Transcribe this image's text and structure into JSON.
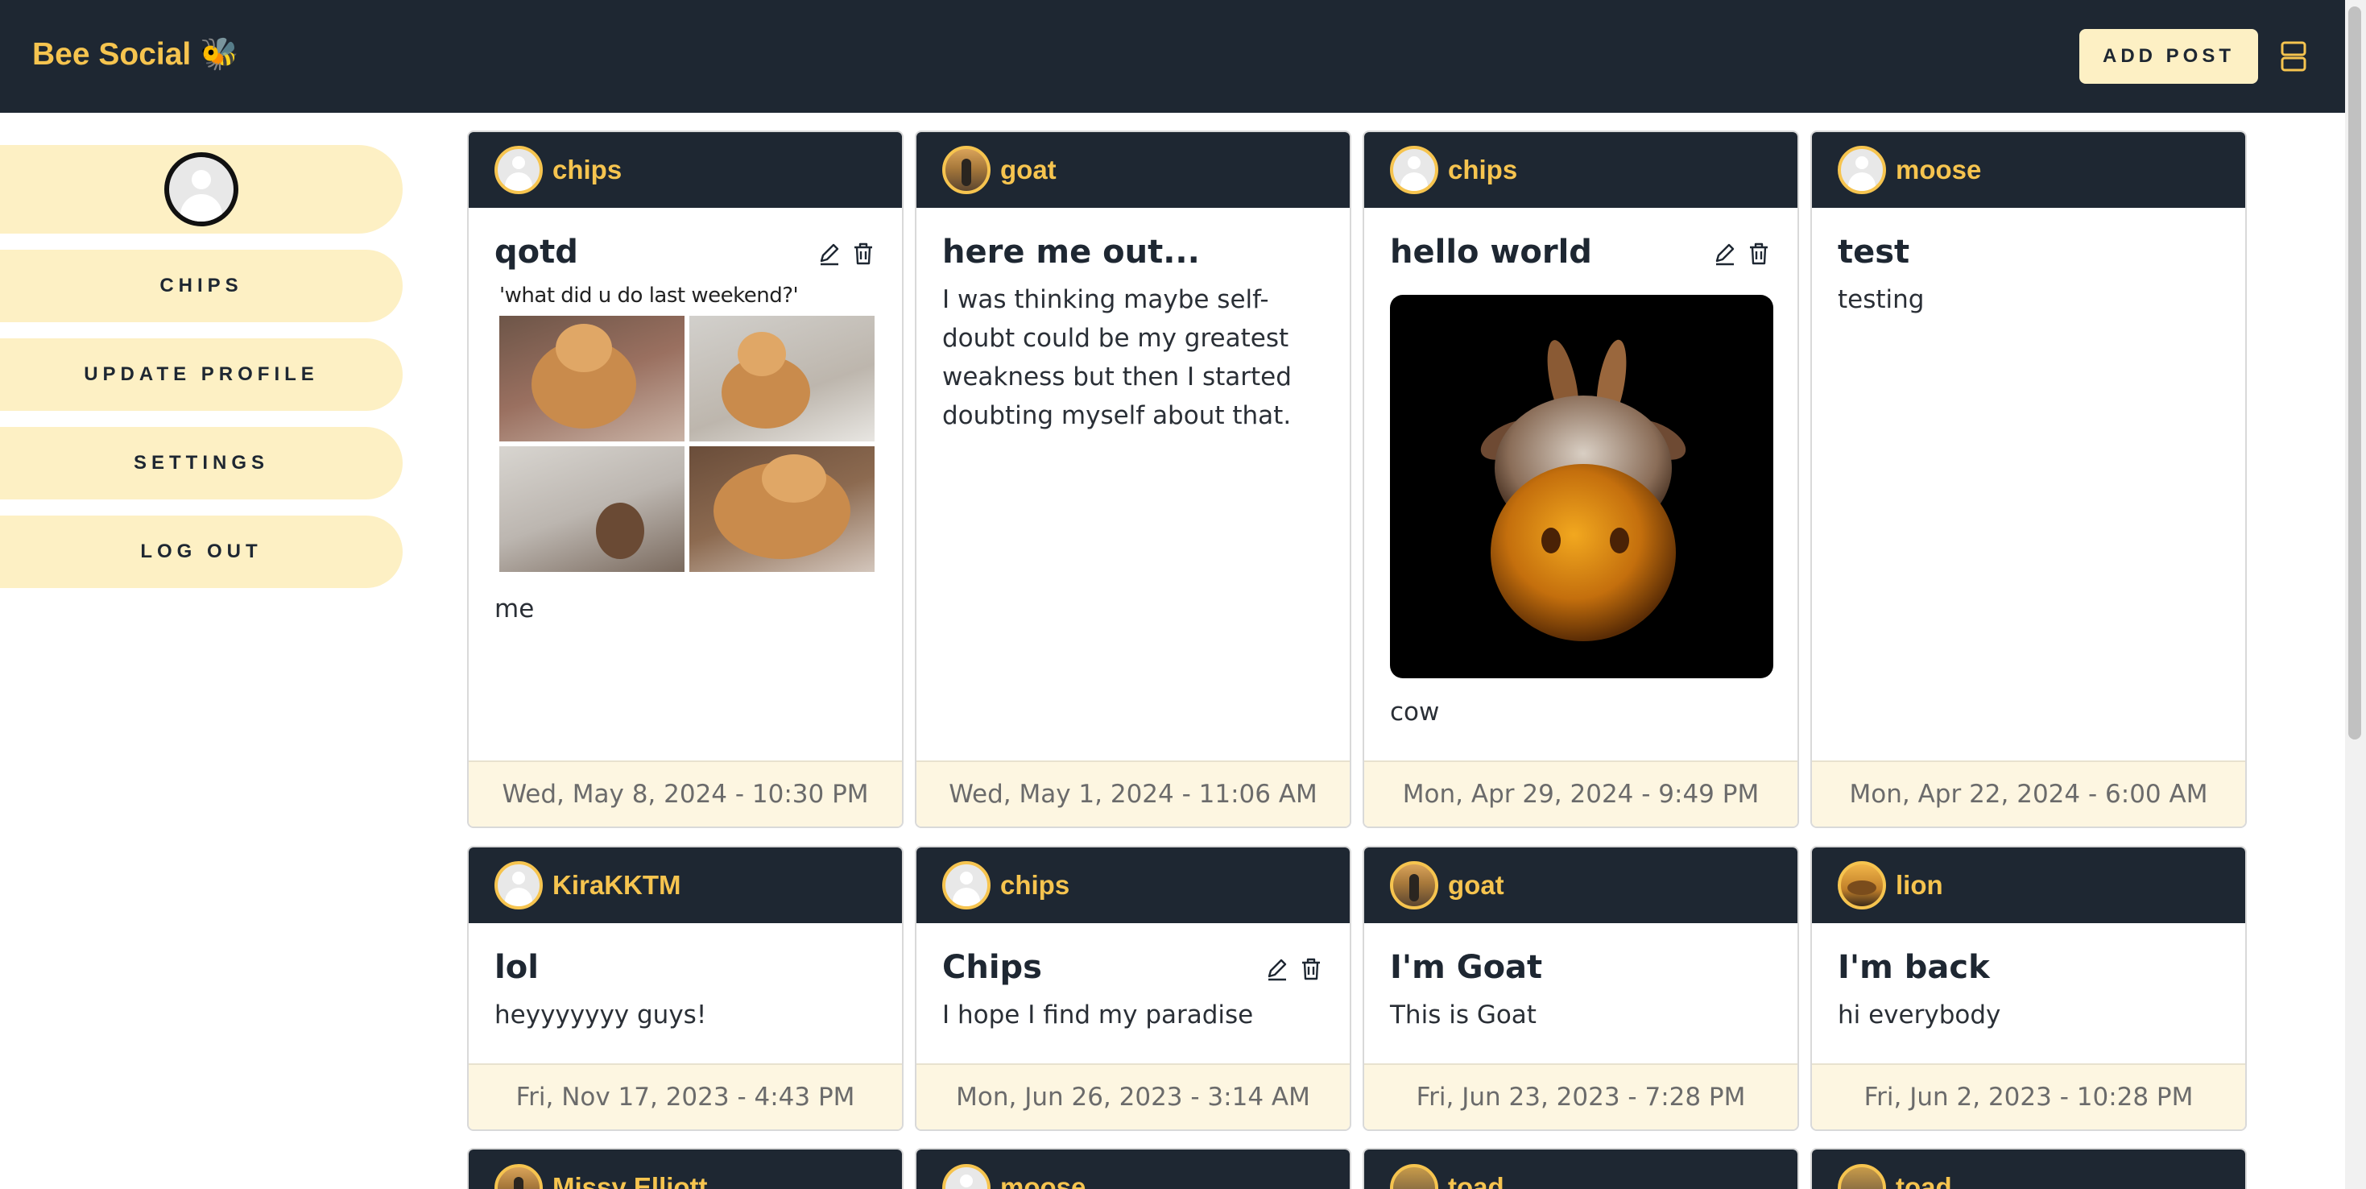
{
  "app": {
    "brand": "Bee Social 🐝",
    "add_post_label": "ADD POST"
  },
  "sidebar": {
    "items": [
      {
        "label": "CHIPS"
      },
      {
        "label": "UPDATE PROFILE"
      },
      {
        "label": "SETTINGS"
      },
      {
        "label": "LOG OUT"
      }
    ]
  },
  "posts": [
    {
      "user": "chips",
      "title": "qotd",
      "meme_caption": "'what did u do last weekend?'",
      "text": "me",
      "date": "Wed, May 8, 2024 - 10:30 PM"
    },
    {
      "user": "goat",
      "title": "here me out...",
      "text": "I was thinking maybe self-doubt could be my greatest weakness but then I started doubting myself about that.",
      "date": "Wed, May 1, 2024 - 11:06 AM"
    },
    {
      "user": "chips",
      "title": "hello world",
      "text": "cow",
      "date": "Mon, Apr 29, 2024 - 9:49 PM"
    },
    {
      "user": "moose",
      "title": "test",
      "text": "testing",
      "date": "Mon, Apr 22, 2024 - 6:00 AM"
    },
    {
      "user": "KiraKKTM",
      "title": "lol",
      "text": "heyyyyyyy guys!",
      "date": "Fri, Nov 17, 2023 - 4:43 PM"
    },
    {
      "user": "chips",
      "title": "Chips",
      "text": "I hope I find my paradise",
      "date": "Mon, Jun 26, 2023 - 3:14 AM"
    },
    {
      "user": "goat",
      "title": "I'm Goat",
      "text": "This is Goat",
      "date": "Fri, Jun 23, 2023 - 7:28 PM"
    },
    {
      "user": "lion",
      "title": "I'm back",
      "text": "hi everybody",
      "date": "Fri, Jun 2, 2023 - 10:28 PM"
    },
    {
      "user": "Missy Elliott"
    },
    {
      "user": "moose"
    },
    {
      "user": "toad"
    },
    {
      "user": "toad"
    }
  ],
  "colors": {
    "navy": "#1e2732",
    "gold": "#f6c44f",
    "cream": "#fdf0c4"
  }
}
